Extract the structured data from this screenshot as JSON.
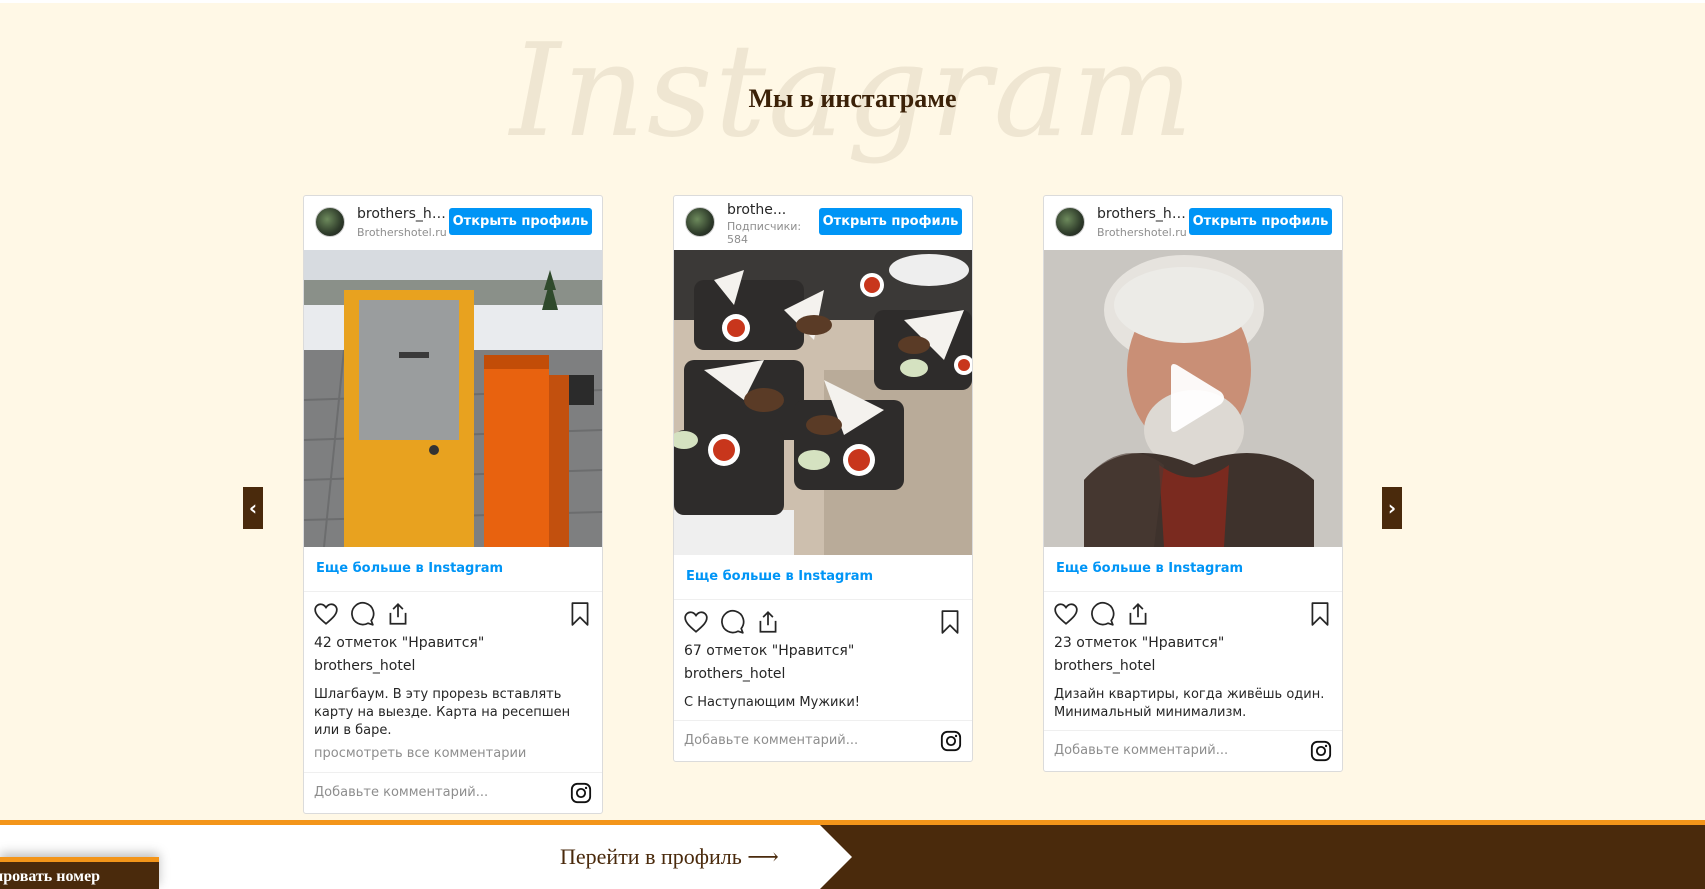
{
  "section": {
    "script_word": "Instagram",
    "title": "Мы в инстаграме"
  },
  "colors": {
    "background": "#fff8e6",
    "brand_brown": "#4a2a0c",
    "accent_orange": "#f3951a",
    "instagram_blue": "#0095f6"
  },
  "carousel": {
    "prev_label": "‹",
    "next_label": "›"
  },
  "posts": [
    {
      "username": "brothers_ho...",
      "subtitle": "Brothershotel.ru ·",
      "follow_label": "Открыть профиль",
      "more_link": "Еще больше в Instagram",
      "likes": "42 отметок \"Нравится\"",
      "owner": "brothers_hotel",
      "caption": "Шлагбаум. В эту прорезь вставлять карту на выезде. Карта на ресепшен или в баре.",
      "view_all": "просмотреть все комментарии",
      "comment_placeholder": "Добавьте комментарий...",
      "media": "photo-barrier-gate"
    },
    {
      "username": "brothe...",
      "subtitle": "Подписчики: 584",
      "follow_label": "Открыть профиль",
      "more_link": "Еще больше в Instagram",
      "likes": "67 отметок \"Нравится\"",
      "owner": "brothers_hotel",
      "caption": "С Наступающим Мужики!",
      "comment_placeholder": "Добавьте комментарий...",
      "media": "photo-food-plates"
    },
    {
      "username": "brothers_ho...",
      "subtitle": "Brothershotel.ru ·",
      "follow_label": "Открыть профиль",
      "more_link": "Еще больше в Instagram",
      "likes": "23 отметок \"Нравится\"",
      "owner": "brothers_hotel",
      "caption": "Дизайн квартиры, когда живёшь один. Минимальный минимализм.",
      "comment_placeholder": "Добавьте комментарий...",
      "media": "video-man-portrait"
    }
  ],
  "footer": {
    "profile_link": "Перейти в профиль ⟶",
    "book_tab": "ировать номер"
  },
  "icons": [
    "heart-icon",
    "comment-icon",
    "share-icon",
    "bookmark-icon",
    "instagram-icon",
    "play-icon"
  ]
}
